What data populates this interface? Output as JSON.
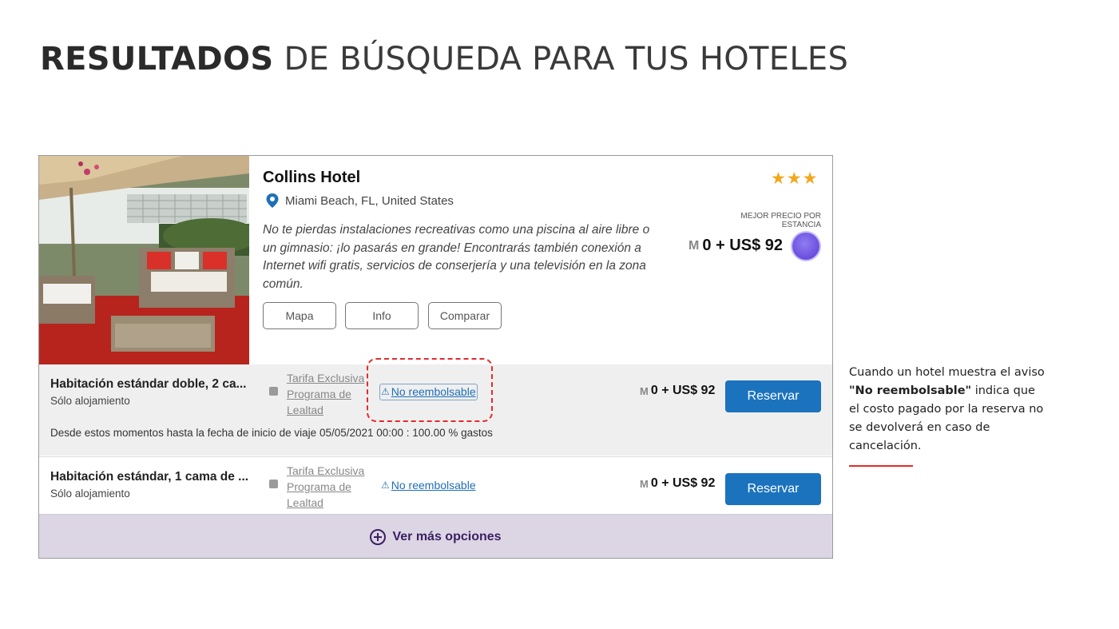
{
  "title": {
    "bold": "RESULTADOS",
    "rest": "DE BÚSQUEDA PARA TUS HOTELES"
  },
  "hotel": {
    "name": "Collins Hotel",
    "location": "Miami Beach, FL, United States",
    "stars": "★★★",
    "star_count": 3,
    "description": "No te pierdas instalaciones recreativas como una piscina al aire libre o un gimnasio: ¡lo pasarás en grande! Encontrarás también conexión a Internet wifi gratis, servicios de conserjería y una televisión en la zona común.",
    "buttons": {
      "map": "Mapa",
      "info": "Info",
      "compare": "Comparar"
    },
    "best_price_label": "MEJOR PRECIO POR ESTANCIA",
    "best_price": "0 + US$ 92"
  },
  "rooms": [
    {
      "name": "Habitación estándar doble, 2 ca...",
      "meal": "Sólo alojamiento",
      "rate": "Tarifa Exclusiva Programa de Lealtad",
      "refund": "No reembolsable",
      "price": "0 + US$ 92",
      "button": "Reservar",
      "policy": "Desde estos momentos hasta la fecha de inicio de viaje 05/05/2021 00:00 : 100.00 % gastos"
    },
    {
      "name": "Habitación estándar, 1 cama de ...",
      "meal": "Sólo alojamiento",
      "rate": "Tarifa Exclusiva Programa de Lealtad",
      "refund": "No reembolsable",
      "price": "0 + US$ 92",
      "button": "Reservar"
    }
  ],
  "more_options": "Ver más opciones",
  "note": {
    "before": "Cuando un hotel muestra el aviso ",
    "strong": "\"No reembolsable\"",
    "after": " indica que el costo pagado por la reserva no se devolverá en caso de cancelación."
  },
  "colors": {
    "accent_blue": "#1b73be",
    "highlight_red": "#e32b2b",
    "star_gold": "#f0a81c",
    "more_bar": "#dcd6e4"
  }
}
